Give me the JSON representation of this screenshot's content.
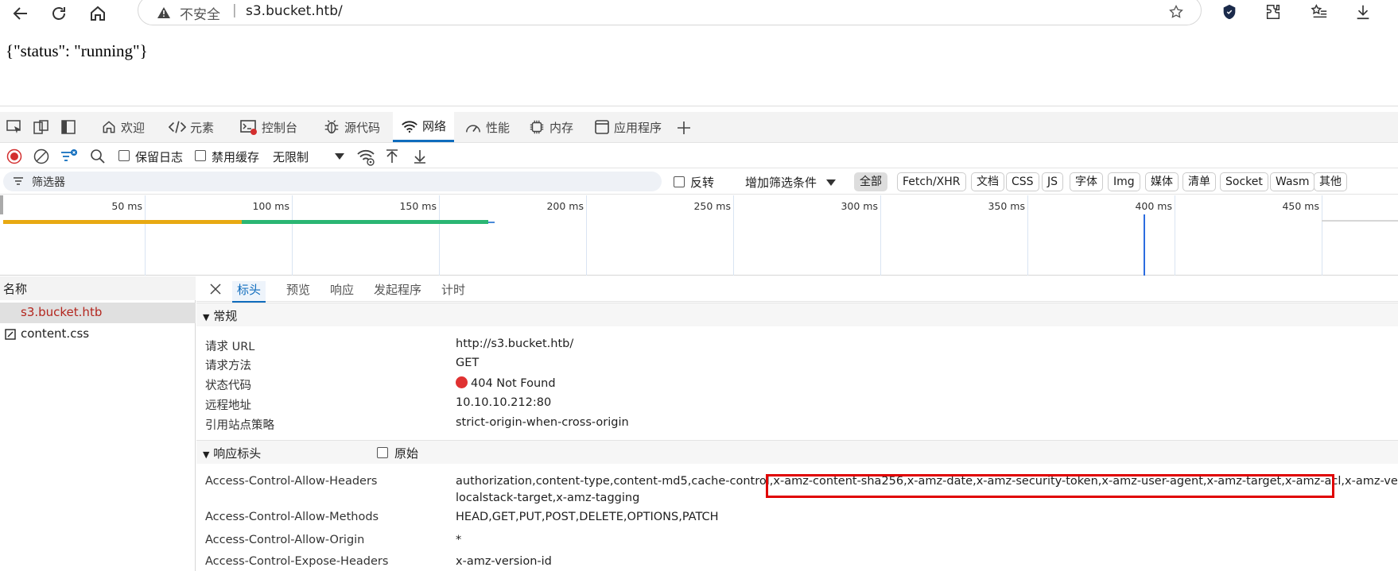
{
  "browser": {
    "insecure_label": "不安全",
    "separator": "|",
    "url": "s3.bucket.htb/"
  },
  "page": {
    "body_text": "{\"status\": \"running\"}"
  },
  "devtools": {
    "tabs": [
      {
        "label": "欢迎",
        "icon": "home-icon"
      },
      {
        "label": "元素",
        "icon": "code-icon"
      },
      {
        "label": "控制台",
        "icon": "console-icon"
      },
      {
        "label": "源代码",
        "icon": "bug-icon"
      },
      {
        "label": "网络",
        "icon": "wifi-icon",
        "active": true
      },
      {
        "label": "性能",
        "icon": "gauge-icon"
      },
      {
        "label": "内存",
        "icon": "chip-icon"
      },
      {
        "label": "应用程序",
        "icon": "app-icon"
      }
    ],
    "toolbar": {
      "preserve_log": "保留日志",
      "disable_cache": "禁用缓存",
      "throttle": "无限制"
    },
    "filter": {
      "placeholder": "筛选器",
      "invert": "反转",
      "more_filters": "增加筛选条件",
      "chips": [
        "全部",
        "Fetch/XHR",
        "文档",
        "CSS",
        "JS",
        "字体",
        "Img",
        "媒体",
        "清单",
        "Socket",
        "Wasm",
        "其他"
      ]
    },
    "timeline": {
      "ticks": [
        "50 ms",
        "100 ms",
        "150 ms",
        "200 ms",
        "250 ms",
        "300 ms",
        "350 ms",
        "400 ms",
        "450 ms"
      ]
    },
    "requests": {
      "header": "名称",
      "items": [
        {
          "name": "s3.bucket.htb",
          "selected": true
        },
        {
          "name": "content.css",
          "selected": false
        }
      ]
    },
    "detail": {
      "tabs": [
        "标头",
        "预览",
        "响应",
        "发起程序",
        "计时"
      ],
      "general": {
        "title": "常规",
        "rows": [
          {
            "k": "请求 URL",
            "v": "http://s3.bucket.htb/"
          },
          {
            "k": "请求方法",
            "v": "GET"
          },
          {
            "k": "状态代码",
            "v": "404 Not Found"
          },
          {
            "k": "远程地址",
            "v": "10.10.10.212:80"
          },
          {
            "k": "引用站点策略",
            "v": "strict-origin-when-cross-origin"
          }
        ]
      },
      "response_headers": {
        "title": "响应标头",
        "raw": "原始",
        "rows": [
          {
            "k": "Access-Control-Allow-Headers",
            "v1": "authorization,content-type,content-md5,cache-control,x-amz-content-sha256,x-amz-date,x-amz-security-token,x-amz-user-agent,x-amz-target,x-amz-acl,x-amz-versi",
            "v2": "localstack-target,x-amz-tagging"
          },
          {
            "k": "Access-Control-Allow-Methods",
            "v": "HEAD,GET,PUT,POST,DELETE,OPTIONS,PATCH"
          },
          {
            "k": "Access-Control-Allow-Origin",
            "v": "*"
          },
          {
            "k": "Access-Control-Expose-Headers",
            "v": "x-amz-version-id"
          }
        ]
      }
    }
  },
  "colors": {
    "accent": "#0f6cbd",
    "highlight": "#e00000",
    "selected_text": "#b3261e",
    "status_dot": "#e03131"
  }
}
